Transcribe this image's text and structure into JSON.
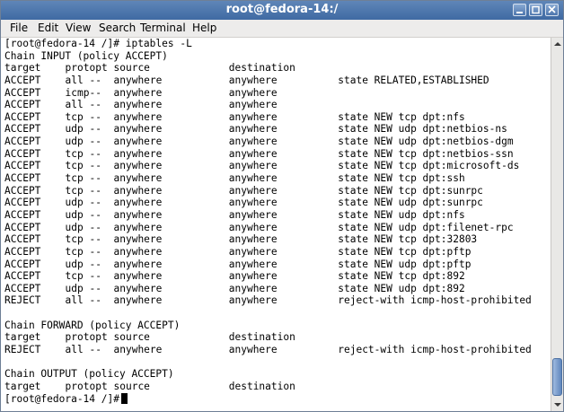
{
  "window": {
    "title": "root@fedora-14:/"
  },
  "menu": [
    "File",
    "Edit",
    "View",
    "Search",
    "Terminal",
    "Help"
  ],
  "terminal": {
    "prompt": "[root@fedora-14 /]#",
    "command": "iptables -L",
    "input_chain": "Chain INPUT (policy ACCEPT)",
    "forward_chain": "Chain FORWARD (policy ACCEPT)",
    "output_chain": "Chain OUTPUT (policy ACCEPT)",
    "header": [
      "target",
      "prot",
      "opt",
      "source",
      "destination",
      ""
    ],
    "input_rules": [
      [
        "ACCEPT",
        "all",
        "--",
        "anywhere",
        "anywhere",
        "state RELATED,ESTABLISHED"
      ],
      [
        "ACCEPT",
        "icmp",
        "--",
        "anywhere",
        "anywhere",
        ""
      ],
      [
        "ACCEPT",
        "all",
        "--",
        "anywhere",
        "anywhere",
        ""
      ],
      [
        "ACCEPT",
        "tcp",
        "--",
        "anywhere",
        "anywhere",
        "state NEW tcp dpt:nfs"
      ],
      [
        "ACCEPT",
        "udp",
        "--",
        "anywhere",
        "anywhere",
        "state NEW udp dpt:netbios-ns"
      ],
      [
        "ACCEPT",
        "udp",
        "--",
        "anywhere",
        "anywhere",
        "state NEW udp dpt:netbios-dgm"
      ],
      [
        "ACCEPT",
        "tcp",
        "--",
        "anywhere",
        "anywhere",
        "state NEW tcp dpt:netbios-ssn"
      ],
      [
        "ACCEPT",
        "tcp",
        "--",
        "anywhere",
        "anywhere",
        "state NEW tcp dpt:microsoft-ds"
      ],
      [
        "ACCEPT",
        "tcp",
        "--",
        "anywhere",
        "anywhere",
        "state NEW tcp dpt:ssh"
      ],
      [
        "ACCEPT",
        "tcp",
        "--",
        "anywhere",
        "anywhere",
        "state NEW tcp dpt:sunrpc"
      ],
      [
        "ACCEPT",
        "udp",
        "--",
        "anywhere",
        "anywhere",
        "state NEW udp dpt:sunrpc"
      ],
      [
        "ACCEPT",
        "udp",
        "--",
        "anywhere",
        "anywhere",
        "state NEW udp dpt:nfs"
      ],
      [
        "ACCEPT",
        "udp",
        "--",
        "anywhere",
        "anywhere",
        "state NEW udp dpt:filenet-rpc"
      ],
      [
        "ACCEPT",
        "tcp",
        "--",
        "anywhere",
        "anywhere",
        "state NEW tcp dpt:32803"
      ],
      [
        "ACCEPT",
        "tcp",
        "--",
        "anywhere",
        "anywhere",
        "state NEW tcp dpt:pftp"
      ],
      [
        "ACCEPT",
        "udp",
        "--",
        "anywhere",
        "anywhere",
        "state NEW udp dpt:pftp"
      ],
      [
        "ACCEPT",
        "tcp",
        "--",
        "anywhere",
        "anywhere",
        "state NEW tcp dpt:892"
      ],
      [
        "ACCEPT",
        "udp",
        "--",
        "anywhere",
        "anywhere",
        "state NEW udp dpt:892"
      ],
      [
        "REJECT",
        "all",
        "--",
        "anywhere",
        "anywhere",
        "reject-with icmp-host-prohibited"
      ]
    ],
    "forward_rules": [
      [
        "REJECT",
        "all",
        "--",
        "anywhere",
        "anywhere",
        "reject-with icmp-host-prohibited"
      ]
    ],
    "output_rules": []
  },
  "icons": {
    "minimize": "minimize-icon",
    "maximize": "maximize-icon",
    "close": "close-icon",
    "scroll_up": "arrow-up-icon",
    "scroll_down": "arrow-down-icon"
  },
  "colors": {
    "titlebar": "#4a74aa",
    "menubar": "#edeceb",
    "terminal_bg": "#ffffff",
    "terminal_fg": "#000000"
  }
}
